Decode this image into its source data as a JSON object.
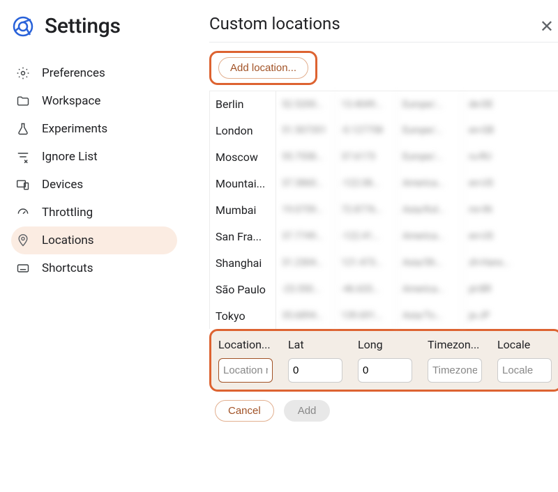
{
  "sidebar": {
    "title": "Settings",
    "items": [
      {
        "label": "Preferences"
      },
      {
        "label": "Workspace"
      },
      {
        "label": "Experiments"
      },
      {
        "label": "Ignore List"
      },
      {
        "label": "Devices"
      },
      {
        "label": "Throttling"
      },
      {
        "label": "Locations"
      },
      {
        "label": "Shortcuts"
      }
    ]
  },
  "header": {
    "title": "Custom locations"
  },
  "addButton": "Add location...",
  "rows": [
    {
      "name": "Berlin",
      "lat": "52.5200...",
      "lng": "13.4049...",
      "tz": "Europe/...",
      "loc": "de-DE"
    },
    {
      "name": "London",
      "lat": "51.507351",
      "lng": "-0.127758",
      "tz": "Europe/...",
      "loc": "en-GB"
    },
    {
      "name": "Moscow",
      "lat": "55.7558...",
      "lng": "37.6173",
      "tz": "Europe/...",
      "loc": "ru-RU"
    },
    {
      "name": "Mountai...",
      "lat": "37.3860...",
      "lng": "-122.08...",
      "tz": "America...",
      "loc": "en-US"
    },
    {
      "name": "Mumbai",
      "lat": "19.0759...",
      "lng": "72.8776...",
      "tz": "Asia/Kol...",
      "loc": "mr-IN"
    },
    {
      "name": "San Fra...",
      "lat": "37.7749...",
      "lng": "-122.41...",
      "tz": "America...",
      "loc": "en-US"
    },
    {
      "name": "Shanghai",
      "lat": "31.2304...",
      "lng": "121.473...",
      "tz": "Asia/Sh...",
      "loc": "zh-Hans..."
    },
    {
      "name": "São Paulo",
      "lat": "-23.550...",
      "lng": "-46.633...",
      "tz": "America...",
      "loc": "pt-BR"
    },
    {
      "name": "Tokyo",
      "lat": "35.6894...",
      "lng": "139.691...",
      "tz": "Asia/To...",
      "loc": "ja-JP"
    }
  ],
  "form": {
    "labels": {
      "name": "Location...",
      "lat": "Lat",
      "lng": "Long",
      "tz": "Timezon...",
      "loc": "Locale"
    },
    "placeholders": {
      "name": "Location name",
      "tz": "Timezone ID",
      "loc": "Locale"
    },
    "values": {
      "lat": "0",
      "lng": "0"
    }
  },
  "footer": {
    "cancel": "Cancel",
    "add": "Add"
  }
}
